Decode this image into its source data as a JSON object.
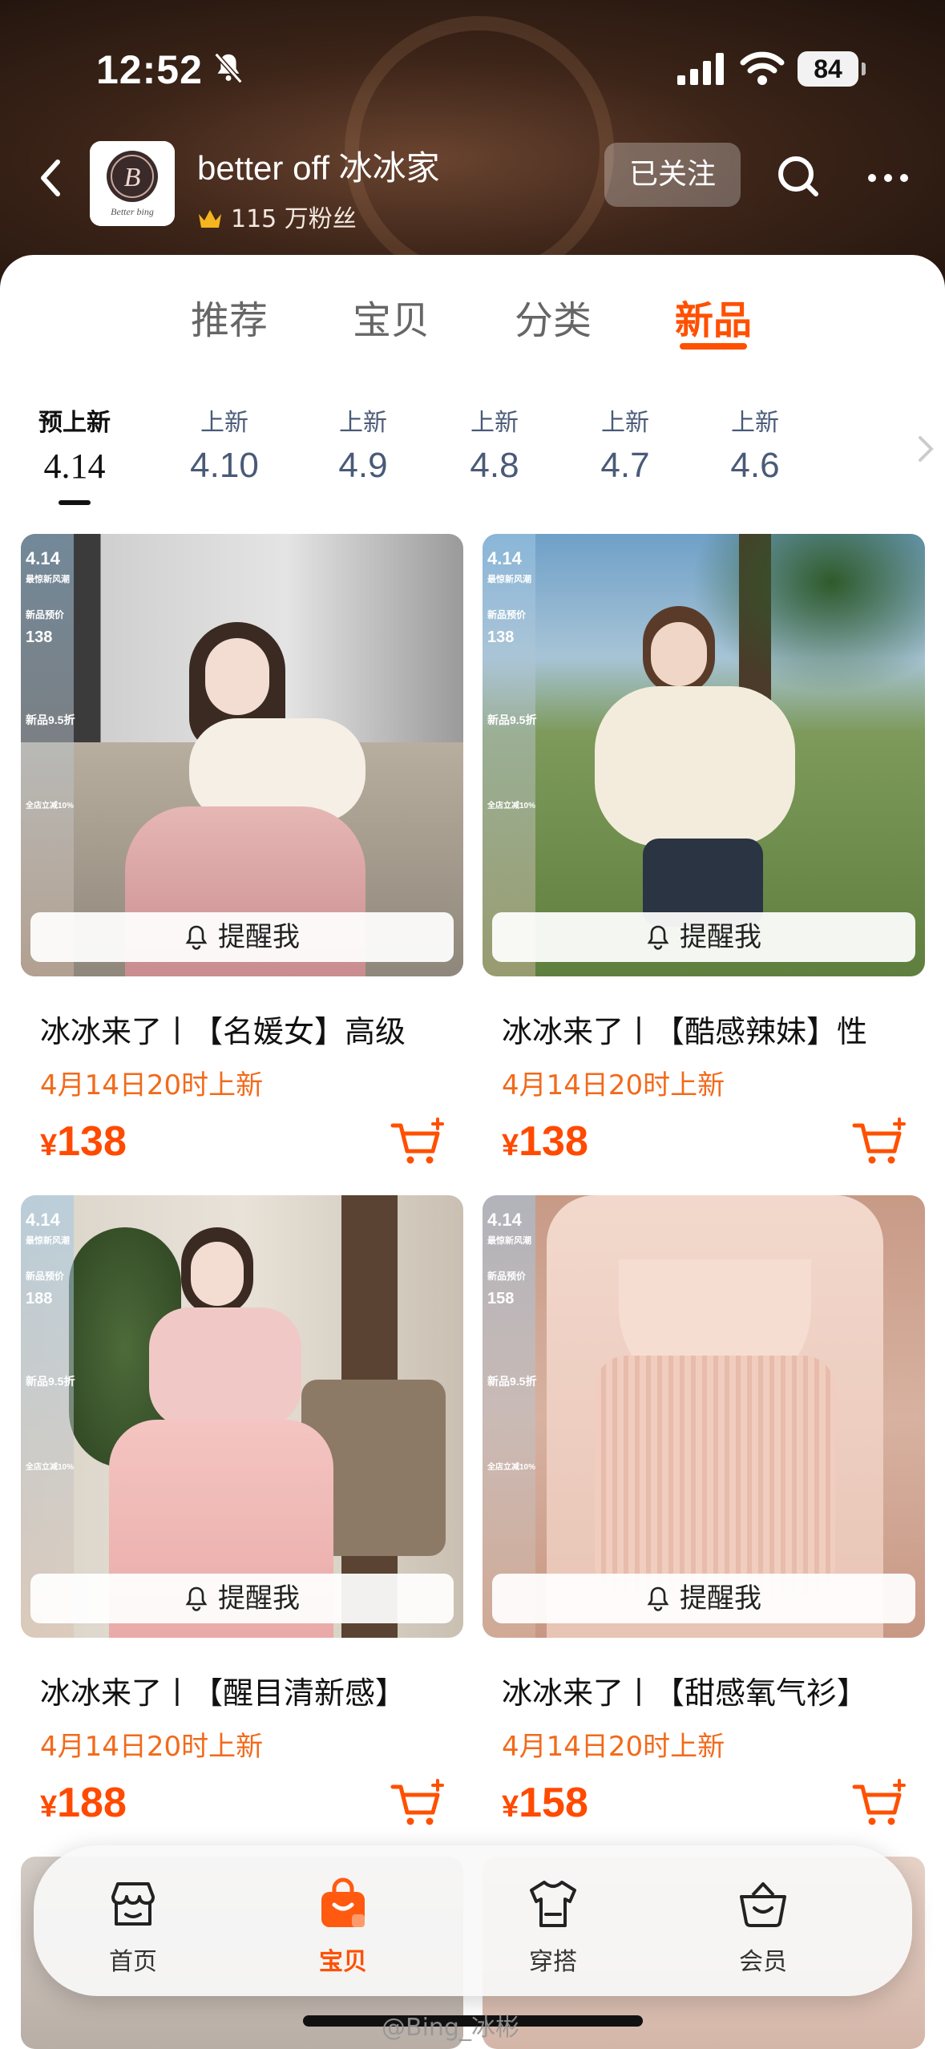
{
  "status_bar": {
    "time": "12:52",
    "battery": "84"
  },
  "shop": {
    "name": "better off 冰冰家",
    "fans": "115 万粉丝",
    "follow_label": "已关注",
    "logo_text": "Better bing"
  },
  "main_tabs": [
    {
      "label": "推荐",
      "active": false
    },
    {
      "label": "宝贝",
      "active": false
    },
    {
      "label": "分类",
      "active": false
    },
    {
      "label": "新品",
      "active": true
    }
  ],
  "date_tabs": [
    {
      "label": "预上新",
      "date": "4.14",
      "active": true
    },
    {
      "label": "上新",
      "date": "4.10",
      "active": false
    },
    {
      "label": "上新",
      "date": "4.9",
      "active": false
    },
    {
      "label": "上新",
      "date": "4.8",
      "active": false
    },
    {
      "label": "上新",
      "date": "4.7",
      "active": false
    },
    {
      "label": "上新",
      "date": "4.6",
      "active": false
    }
  ],
  "remind_label": "提醒我",
  "products": [
    {
      "title": "冰冰来了丨【名媛女】高级",
      "launch": "4月14日20时上新",
      "currency": "¥",
      "price": "138",
      "badge_price": "138"
    },
    {
      "title": "冰冰来了丨【酷感辣妹】性",
      "launch": "4月14日20时上新",
      "currency": "¥",
      "price": "138",
      "badge_price": "138"
    },
    {
      "title": "冰冰来了丨【醒目清新感】",
      "launch": "4月14日20时上新",
      "currency": "¥",
      "price": "188",
      "badge_price": "188"
    },
    {
      "title": "冰冰来了丨【甜感氧气衫】",
      "launch": "4月14日20时上新",
      "currency": "¥",
      "price": "158",
      "badge_price": "158"
    }
  ],
  "promo_strip": {
    "date": "4.14",
    "line2": "最惊新风潮",
    "line3": "新品预价",
    "discount": "新品9.5折",
    "store": "全店立减10%"
  },
  "bottom_nav": [
    {
      "label": "首页",
      "icon": "store-icon",
      "active": false
    },
    {
      "label": "宝贝",
      "icon": "bag-icon",
      "active": true
    },
    {
      "label": "穿搭",
      "icon": "shirt-icon",
      "active": false
    },
    {
      "label": "会员",
      "icon": "member-basket-icon",
      "active": false
    }
  ],
  "watermark": "@Bing_冰彬",
  "colors": {
    "accent": "#ff5000",
    "price": "#ff4a00",
    "launch": "#f26a1b"
  }
}
